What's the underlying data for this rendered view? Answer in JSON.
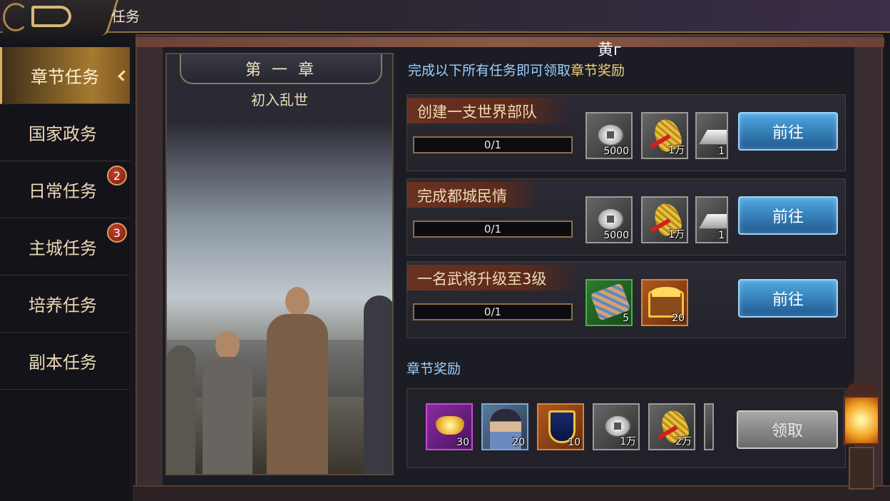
{
  "header": {
    "title": "任务",
    "top_text": "黄г"
  },
  "sidebar": {
    "items": [
      {
        "label": "章节任务",
        "active": true,
        "badge": ""
      },
      {
        "label": "国家政务",
        "active": false,
        "badge": ""
      },
      {
        "label": "日常任务",
        "active": false,
        "badge": "2"
      },
      {
        "label": "主城任务",
        "active": false,
        "badge": "3"
      },
      {
        "label": "培养任务",
        "active": false,
        "badge": ""
      },
      {
        "label": "副本任务",
        "active": false,
        "badge": ""
      }
    ]
  },
  "chapter": {
    "number": "第 一 章",
    "name": "初入乱世"
  },
  "intro": {
    "prefix": "完成以下所有任务即可领取",
    "highlight": "章节奖励"
  },
  "tasks": [
    {
      "name": "创建一支世界部队",
      "progress": "0/1",
      "rewards": [
        {
          "icon": "silver-coin-icon",
          "qty": "5000"
        },
        {
          "icon": "grain-icon",
          "qty": "1万"
        },
        {
          "icon": "iron-ingot-icon",
          "qty": "1"
        }
      ],
      "button": "前往"
    },
    {
      "name": "完成都城民情",
      "progress": "0/1",
      "rewards": [
        {
          "icon": "silver-coin-icon",
          "qty": "5000"
        },
        {
          "icon": "grain-icon",
          "qty": "1万"
        },
        {
          "icon": "iron-ingot-icon",
          "qty": "1"
        }
      ],
      "button": "前往"
    },
    {
      "name": "一名武将升级至3级",
      "progress": "0/1",
      "rewards": [
        {
          "icon": "scroll-icon",
          "qty": "5"
        },
        {
          "icon": "treasure-chest-icon",
          "qty": "20"
        }
      ],
      "button": "前往"
    }
  ],
  "chapter_reward": {
    "label": "章节奖励",
    "items": [
      {
        "icon": "gold-ingot-icon",
        "qty": "30"
      },
      {
        "icon": "hero-portrait-icon",
        "qty": "20"
      },
      {
        "icon": "banner-icon",
        "qty": "10"
      },
      {
        "icon": "silver-coin-icon",
        "qty": "1万"
      },
      {
        "icon": "grain-icon",
        "qty": "2万"
      }
    ],
    "button": "领取"
  },
  "colors": {
    "accent_gold": "#d9b060",
    "button_blue": "#2f7ab8",
    "intro_blue": "#9ad0ff"
  }
}
